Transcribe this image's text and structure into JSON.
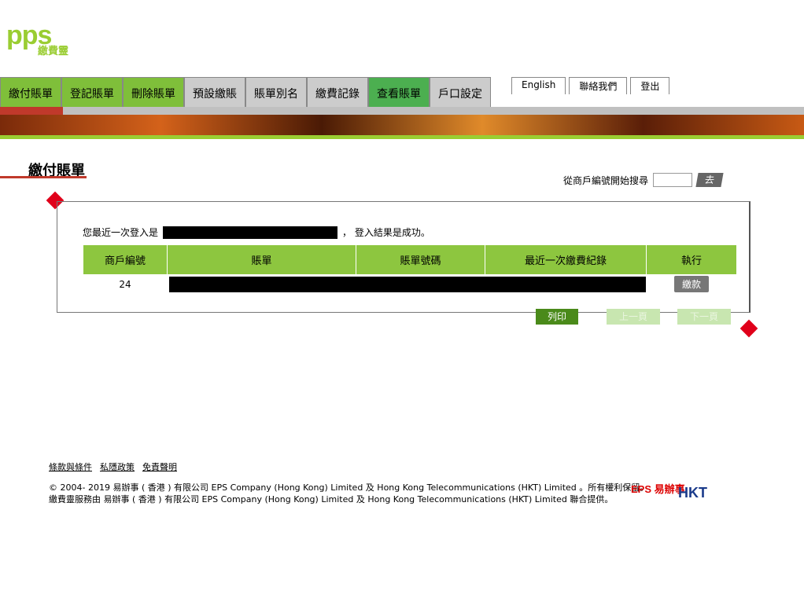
{
  "logo": {
    "text": "pps",
    "subtitle": "繳費靈"
  },
  "tabs": [
    {
      "label": "繳付賬單"
    },
    {
      "label": "登記賬單"
    },
    {
      "label": "刪除賬單"
    },
    {
      "label": "預設繳賬"
    },
    {
      "label": "賬單別名"
    },
    {
      "label": "繳費記錄"
    },
    {
      "label": "查看賬單"
    },
    {
      "label": "戶口設定"
    }
  ],
  "util_tabs": [
    {
      "label": "English"
    },
    {
      "label": "聯絡我們"
    },
    {
      "label": "登出"
    }
  ],
  "page_title": "繳付賬單",
  "search": {
    "label": "從商戶編號開始搜尋",
    "go_label": "去"
  },
  "status": {
    "prefix": "您最近一次登入是",
    "suffix": "， 登入結果是成功。"
  },
  "table": {
    "headers": [
      "商戶編號",
      "賬單",
      "賬單號碼",
      "最近一次繳費紀錄",
      "執行"
    ],
    "rows": [
      {
        "merchant_no": "24",
        "action": "繳款"
      }
    ]
  },
  "buttons": {
    "print": "列印",
    "prev": "上一頁",
    "next": "下一頁"
  },
  "footer": {
    "links": [
      "條款與條件",
      "私隱政策",
      "免責聲明"
    ],
    "copyright_1": "© 2004- 2019 易辦事 ( 香港 ) 有限公司 EPS Company (Hong Kong) Limited 及 Hong Kong Telecommunications (HKT) Limited 。所有權利保留。",
    "copyright_2": "繳費靈服務由 易辦事 ( 香港 ) 有限公司 EPS Company (Hong Kong) Limited 及 Hong Kong Telecommunications (HKT) Limited 聯合提供。",
    "eps_logo": "EPS 易辦事",
    "hkt_logo": "HKT"
  }
}
